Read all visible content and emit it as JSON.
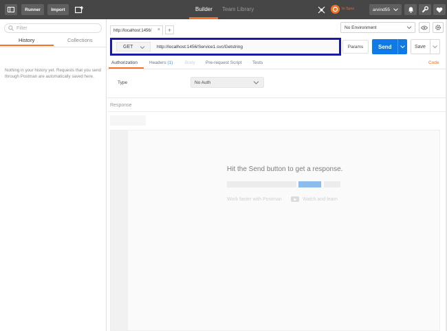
{
  "topbar": {
    "runner_label": "Runner",
    "import_label": "Import",
    "center_tabs": [
      {
        "label": "Builder",
        "active": true
      },
      {
        "label": "Team Library",
        "active": false
      }
    ],
    "sync_status": "In Sync",
    "user_name": "arvind55"
  },
  "sidebar": {
    "filter_placeholder": "Filter",
    "tabs": [
      {
        "label": "History",
        "active": true
      },
      {
        "label": "Collections",
        "active": false
      }
    ],
    "empty_message": "Nothing in your history yet. Requests that you send through Postman are automatically saved here."
  },
  "request": {
    "tab_label": "http://localhost:1456/",
    "close_glyph": "×",
    "add_tab_glyph": "+",
    "environment": "No Environment",
    "method": "GET",
    "url": "http://localhost:1456/Service1.svc/Getstring",
    "params_label": "Params",
    "send_label": "Send",
    "save_label": "Save",
    "sub_tabs": [
      {
        "label": "Authorization",
        "active": true
      },
      {
        "label": "Headers",
        "count": "(1)"
      },
      {
        "label": "Body",
        "disabled": true
      },
      {
        "label": "Pre-request Script"
      },
      {
        "label": "Tests"
      }
    ],
    "code_link": "Code",
    "auth": {
      "type_label": "Type",
      "type_value": "No Auth"
    }
  },
  "response": {
    "label": "Response",
    "hint": "Hit the Send button to get a response.",
    "work_faster": "Work faster with Postman",
    "watch_label": "Watch and learn"
  },
  "colors": {
    "accent": "#f47023",
    "send_blue": "#0f7ae5",
    "highlight_border": "#1a1aa6",
    "topbar": "#464646"
  }
}
